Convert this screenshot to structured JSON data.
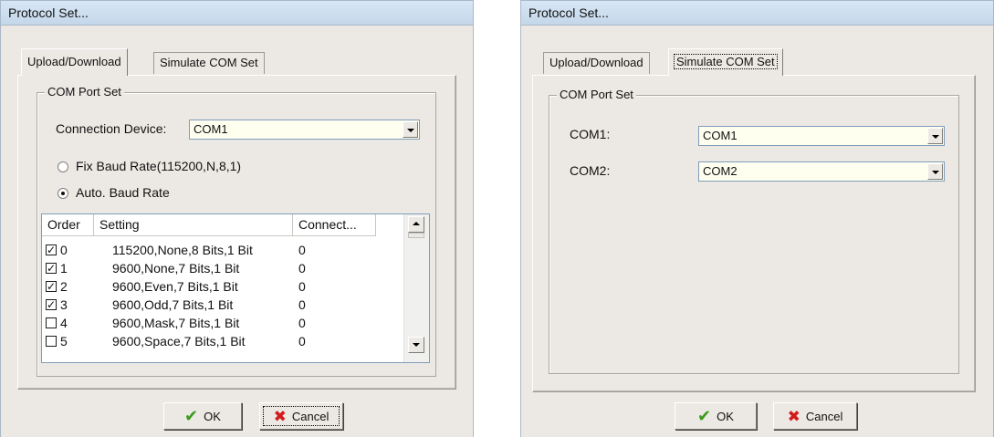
{
  "dialog1": {
    "title": "Protocol Set...",
    "tabs": [
      "Upload/Download",
      "Simulate COM Set"
    ],
    "active_tab": "Upload/Download",
    "group_title": "COM Port Set",
    "connection_label": "Connection Device:",
    "connection_value": "COM1",
    "radio_fix_label": "Fix Baud Rate(115200,N,8,1)",
    "radio_auto_label": "Auto. Baud Rate",
    "selected_radio": "Auto. Baud Rate",
    "columns": [
      "Order",
      "Setting",
      "Connect..."
    ],
    "rows": [
      {
        "order": "0",
        "checked": true,
        "setting": "115200,None,8 Bits,1 Bit",
        "connect": "0"
      },
      {
        "order": "1",
        "checked": true,
        "setting": "9600,None,7 Bits,1 Bit",
        "connect": "0"
      },
      {
        "order": "2",
        "checked": true,
        "setting": "9600,Even,7 Bits,1 Bit",
        "connect": "0"
      },
      {
        "order": "3",
        "checked": true,
        "setting": "9600,Odd,7 Bits,1 Bit",
        "connect": "0"
      },
      {
        "order": "4",
        "checked": false,
        "setting": "9600,Mask,7 Bits,1 Bit",
        "connect": "0"
      },
      {
        "order": "5",
        "checked": false,
        "setting": "9600,Space,7 Bits,1 Bit",
        "connect": "0"
      }
    ],
    "ok_label": "OK",
    "cancel_label": "Cancel"
  },
  "dialog2": {
    "title": "Protocol Set...",
    "tabs": [
      "Upload/Download",
      "Simulate COM Set"
    ],
    "active_tab": "Simulate COM Set",
    "group_title": "COM Port Set",
    "com1_label": "COM1:",
    "com1_value": "COM1",
    "com2_label": "COM2:",
    "com2_value": "COM2",
    "ok_label": "OK",
    "cancel_label": "Cancel"
  },
  "icons": {
    "ok": "checkmark-icon",
    "cancel": "x-icon"
  },
  "colors": {
    "title_bar": "#c4d7ea",
    "dialog_bg": "#ece9e4",
    "combo_bg": "#fffff0",
    "ok_icon": "#3a9a1a",
    "cancel_icon": "#d21c1c"
  }
}
